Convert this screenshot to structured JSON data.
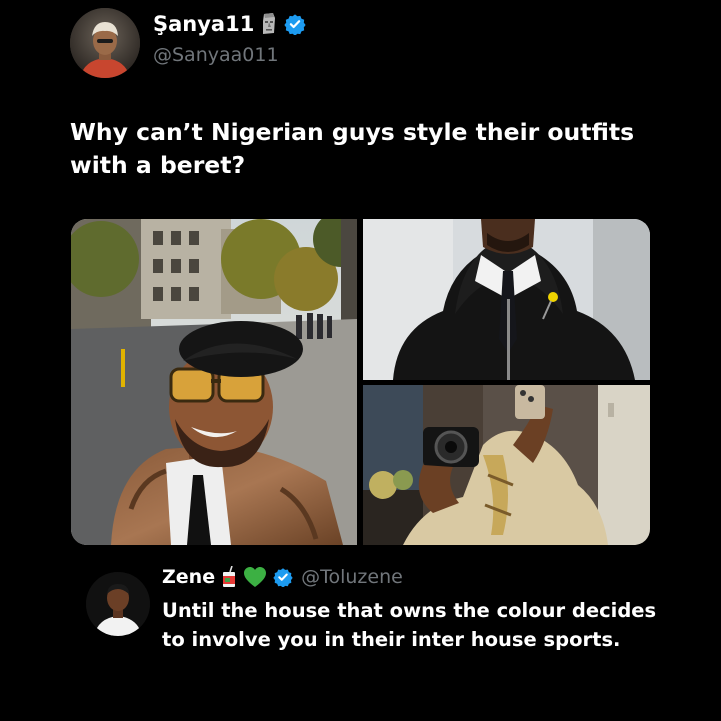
{
  "tweet": {
    "author": {
      "display_name": "Şanya11",
      "handle": "@Sanyaa011",
      "name_emoji": "moai-icon",
      "verified": true
    },
    "text": "Why can’t Nigerian guys style their outfits with a beret?",
    "media": [
      {
        "icon": "photo-man-beret-fur-coat"
      },
      {
        "icon": "photo-black-hoodie-tie"
      },
      {
        "icon": "photo-mirror-selfie-camera"
      }
    ]
  },
  "reply": {
    "author": {
      "display_name": "Zene",
      "handle": "@Toluzene",
      "name_emojis": [
        "juice-box-icon",
        "green-heart-icon"
      ],
      "verified": true
    },
    "text": "Until the house that owns the colour decides to involve you in their inter house sports."
  },
  "colors": {
    "background": "#000000",
    "text_primary": "#ffffff",
    "text_secondary": "#71767b",
    "verified_badge": "#1d9bf0",
    "green_heart": "#3cb043"
  }
}
